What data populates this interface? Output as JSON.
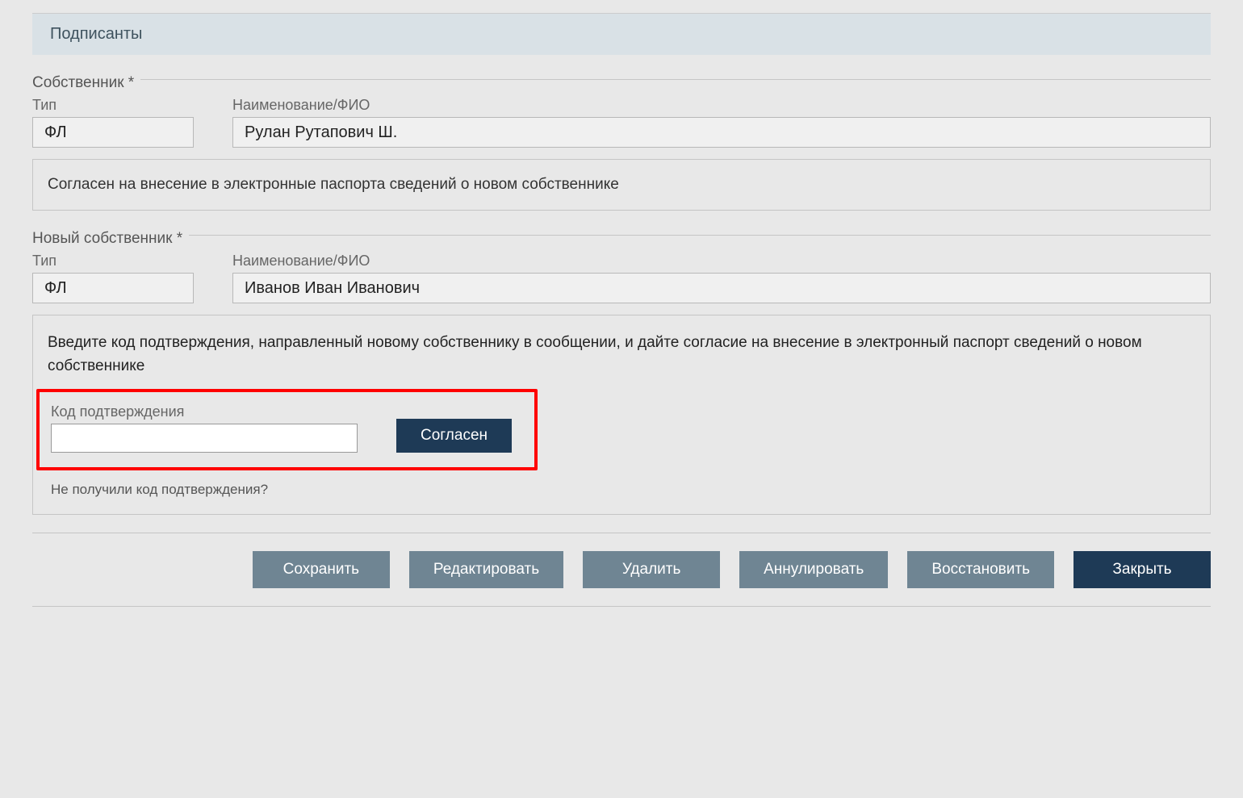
{
  "panel": {
    "title": "Подписанты"
  },
  "owner_section": {
    "legend": "Собственник *",
    "type_label": "Тип",
    "type_value": "ФЛ",
    "name_label": "Наименование/ФИО",
    "name_value": "Рулан Рутапович Ш.",
    "consent_text": "Согласен на внесение в электронные паспорта сведений о новом собственнике"
  },
  "new_owner_section": {
    "legend": "Новый собственник *",
    "type_label": "Тип",
    "type_value": "ФЛ",
    "name_label": "Наименование/ФИО",
    "name_value": "Иванов Иван Иванович"
  },
  "confirm_box": {
    "instructions": "Введите код подтверждения, направленный новому собственнику в сообщении, и дайте согласие на внесение в электронный паспорт сведений о новом собственнике",
    "code_label": "Код подтверждения",
    "code_value": "",
    "agree_button": "Согласен",
    "no_code_text": "Не получили код подтверждения?"
  },
  "buttons": {
    "save": "Сохранить",
    "edit": "Редактировать",
    "delete": "Удалить",
    "cancel": "Аннулировать",
    "restore": "Восстановить",
    "close": "Закрыть"
  },
  "colors": {
    "accent_dark": "#1e3a56",
    "btn_grey": "#6f8593",
    "highlight_red": "#f00"
  }
}
